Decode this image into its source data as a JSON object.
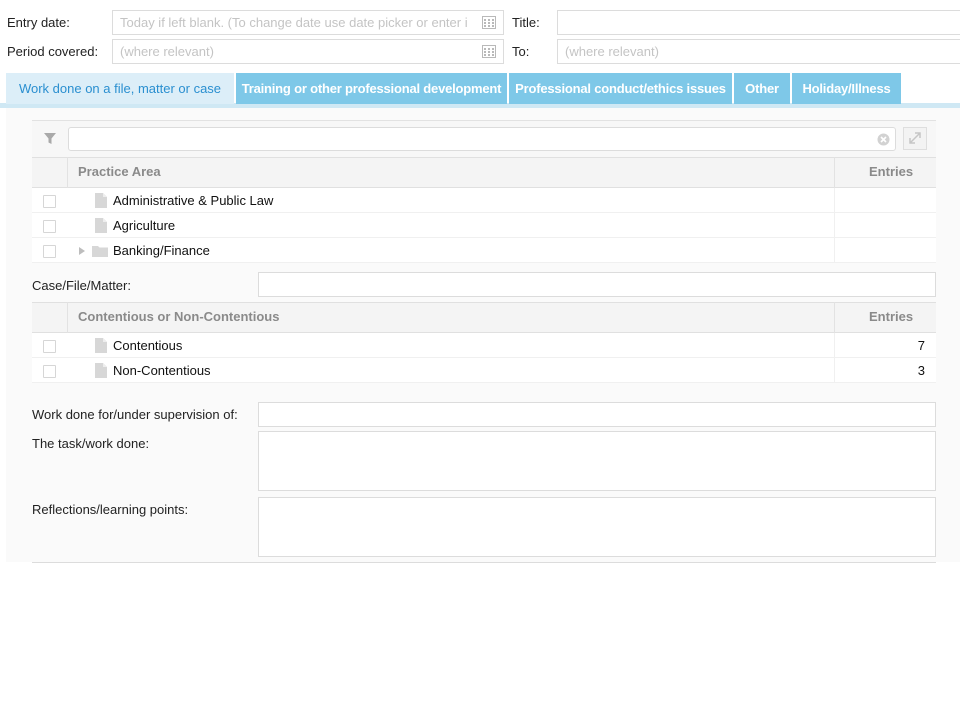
{
  "top_form": {
    "entry_date": {
      "label": "Entry date:",
      "placeholder": "Today if left blank. (To change date use date picker or enter i"
    },
    "title": {
      "label": "Title:",
      "value": ""
    },
    "period_covered": {
      "label": "Period covered:",
      "placeholder": "(where relevant)"
    },
    "to": {
      "label": "To:",
      "placeholder": "(where relevant)"
    }
  },
  "tabs": [
    {
      "label": "Work done on a file, matter or case",
      "active": true
    },
    {
      "label": "Training or other professional development",
      "active": false
    },
    {
      "label": "Professional conduct/ethics issues",
      "active": false
    },
    {
      "label": "Other",
      "active": false
    },
    {
      "label": "Holiday/Illness",
      "active": false
    }
  ],
  "practice_grid": {
    "filter_placeholder": "",
    "columns": {
      "name": "Practice Area",
      "entries": "Entries"
    },
    "rows": [
      {
        "name": "Administrative & Public Law",
        "entries": "",
        "type": "doc"
      },
      {
        "name": "Agriculture",
        "entries": "",
        "type": "doc"
      },
      {
        "name": "Banking/Finance",
        "entries": "",
        "type": "folder"
      }
    ]
  },
  "case_file": {
    "label": "Case/File/Matter:",
    "value": ""
  },
  "contentious_grid": {
    "columns": {
      "name": "Contentious or Non-Contentious",
      "entries": "Entries"
    },
    "rows": [
      {
        "name": "Contentious",
        "entries": "7"
      },
      {
        "name": "Non-Contentious",
        "entries": "3"
      }
    ]
  },
  "supervision": {
    "label": "Work done for/under supervision of:",
    "value": ""
  },
  "task": {
    "label": "The task/work done:",
    "value": ""
  },
  "reflections": {
    "label": "Reflections/learning points:",
    "value": ""
  },
  "colors": {
    "tab_active_bg": "#dceef8",
    "tab_active_text": "#2a8fd0",
    "tab_inactive_bg": "#7ec8e8"
  },
  "icons": [
    "calendar-icon",
    "filter-icon",
    "clear-icon",
    "expand-icon",
    "document-icon",
    "folder-icon",
    "expand-arrow-icon"
  ]
}
